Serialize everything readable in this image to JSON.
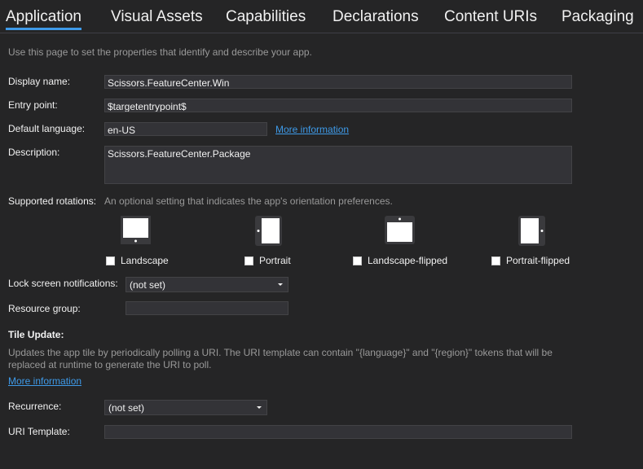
{
  "tabs": [
    {
      "label": "Application",
      "active": true
    },
    {
      "label": "Visual Assets",
      "active": false
    },
    {
      "label": "Capabilities",
      "active": false
    },
    {
      "label": "Declarations",
      "active": false
    },
    {
      "label": "Content URIs",
      "active": false
    },
    {
      "label": "Packaging",
      "active": false
    }
  ],
  "intro": "Use this page to set the properties that identify and describe your app.",
  "display_name": {
    "label": "Display name:",
    "value": "Scissors.FeatureCenter.Win"
  },
  "entry_point": {
    "label": "Entry point:",
    "value": "$targetentrypoint$"
  },
  "default_language": {
    "label": "Default language:",
    "value": "en-US",
    "link": "More information"
  },
  "description": {
    "label": "Description:",
    "value": "Scissors.FeatureCenter.Package"
  },
  "rotations": {
    "label": "Supported rotations:",
    "hint": "An optional setting that indicates the app's orientation preferences.",
    "options": [
      {
        "label": "Landscape",
        "checked": false,
        "icon": "landscape-device-icon"
      },
      {
        "label": "Portrait",
        "checked": false,
        "icon": "portrait-device-icon"
      },
      {
        "label": "Landscape-flipped",
        "checked": false,
        "icon": "landscape-flipped-device-icon"
      },
      {
        "label": "Portrait-flipped",
        "checked": false,
        "icon": "portrait-flipped-device-icon"
      }
    ]
  },
  "lock_screen": {
    "label": "Lock screen notifications:",
    "value": "(not set)"
  },
  "resource_group": {
    "label": "Resource group:",
    "value": ""
  },
  "tile_update": {
    "heading": "Tile Update:",
    "desc_line1": "Updates the app tile by periodically polling a URI. The URI template can contain \"{language}\" and \"{region}\" tokens that will be",
    "desc_line2": "replaced at runtime to generate the URI to poll.",
    "link": "More information"
  },
  "recurrence": {
    "label": "Recurrence:",
    "value": "(not set)"
  },
  "uri_template": {
    "label": "URI Template:",
    "value": ""
  },
  "colors": {
    "background": "#252526",
    "accent": "#3e9ae8",
    "field": "#333337",
    "hint": "#999999"
  }
}
